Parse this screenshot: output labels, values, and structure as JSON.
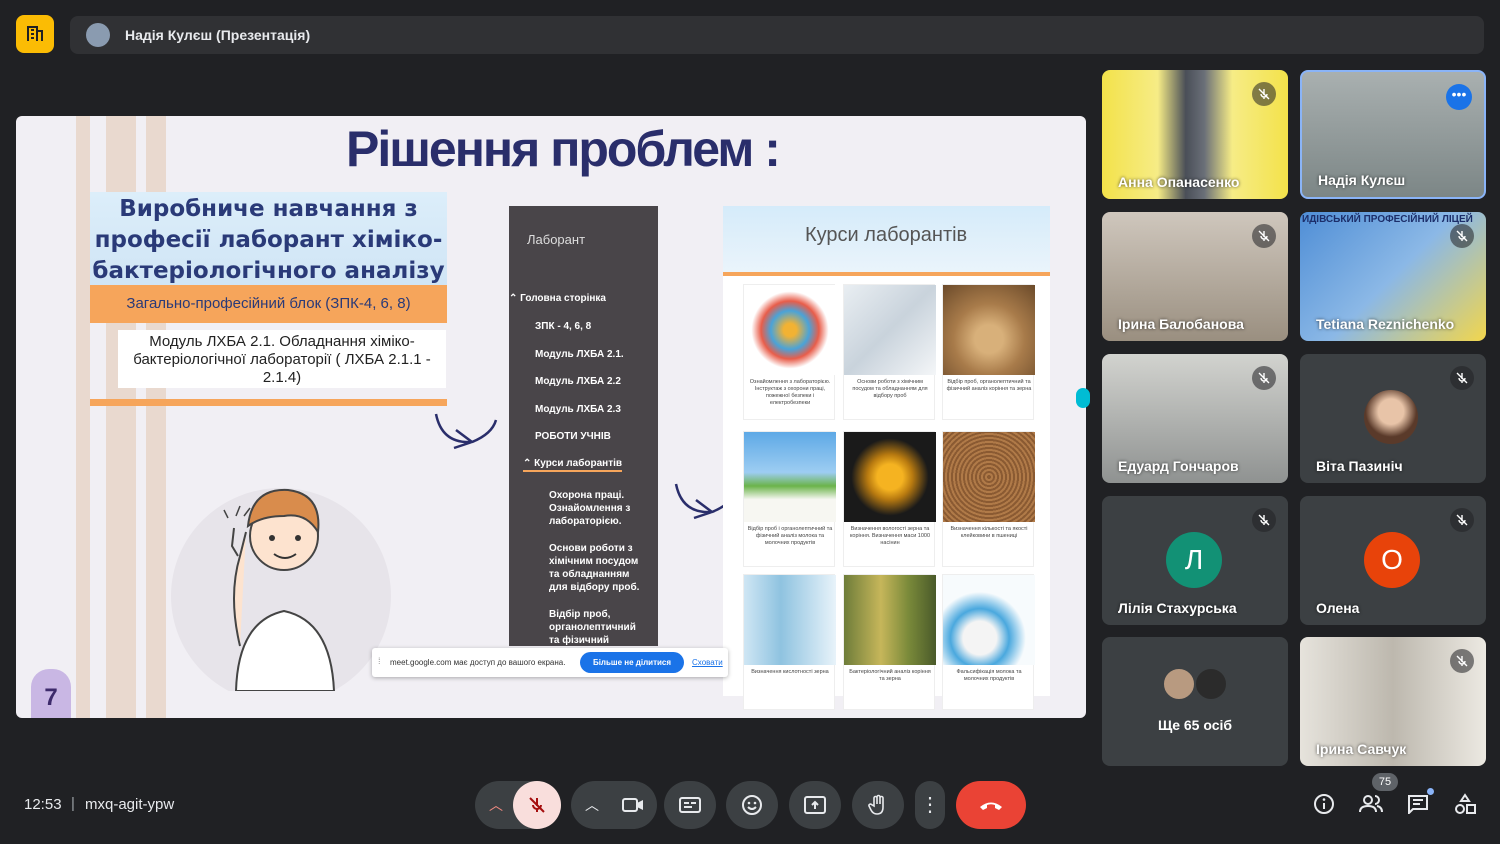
{
  "header": {
    "presenter_title": "Надія Кулєш (Презентація)"
  },
  "slide": {
    "title": "Рішення проблем :",
    "card_title": "Виробниче навчання з професії лаборант хіміко-бактеріологічного аналізу",
    "block_label": "Загально-професійний блок (ЗПК-4, 6, 8)",
    "module_label": "Модуль ЛХБА 2.1. Обладнання хіміко-бактеріологічної лабораторії ( ЛХБА 2.1.1 - 2.1.4)",
    "page_number": "7",
    "nav": {
      "heading": "Лаборант",
      "items": [
        "⌃ Головна сторінка",
        "ЗПК - 4, 6, 8",
        "Модуль ЛХБА 2.1.",
        "Модуль ЛХБА 2.2",
        "Модуль ЛХБА 2.3",
        "РОБОТИ УЧНІВ",
        "⌃ Курси лаборантів",
        "Охорона праці. Ознайомлення з лабораторією.",
        "Основи роботи з хімічним посудом та обладнанням для відбору проб.",
        "Відбір проб, органолептичний та фізичний"
      ]
    },
    "courses": {
      "title": "Курси лаборантів",
      "captions": [
        "Ознайомлення з лабораторією. Інструктаж з охорони праці, пожежної безпеки і електробезпеки",
        "Основи роботи з хімічним посудом та обладнанням для відбору проб",
        "Відбір проб, органолептичний та фізичний аналіз коріння та зерна",
        "Відбір проб і органолептичний та фізичний аналіз молока та молочних продуктів",
        "Визначення вологості зерна та коріння. Визначення маси 1000 насінин",
        "Визначення кількості та якості клейковини в пшениці",
        "Визначення кислотності зерна",
        "Бактеріологічний аналіз коріння та зерна",
        "Фальсифікація молока та молочних продуктів"
      ]
    },
    "share_banner": {
      "text": "meet.google.com має доступ до вашого екрана.",
      "stop_label": "Більше не ділитися",
      "hide_label": "Сховати"
    }
  },
  "participants": [
    {
      "name": "Анна Опанасенко",
      "muted": true
    },
    {
      "name": "Надія Кулєш",
      "muted": false
    },
    {
      "name": "Ірина Балобанова",
      "muted": true
    },
    {
      "name": "Tetiana Reznichenko",
      "muted": true,
      "banner": "ИДІВСЬКИЙ ПРОФЕСІЙНИЙ ЛІЦЕЙ"
    },
    {
      "name": "Едуард Гончаров",
      "muted": true
    },
    {
      "name": "Віта Пазиніч",
      "muted": true
    },
    {
      "name": "Лілія Стахурська",
      "muted": true,
      "initial": "Л",
      "color": "#129175"
    },
    {
      "name": "Олена",
      "muted": true,
      "initial": "О",
      "color": "#e8430a"
    },
    {
      "name": "Ще 65 осіб"
    },
    {
      "name": "Ірина Савчук",
      "muted": true
    }
  ],
  "footer": {
    "time": "12:53",
    "meeting_code": "mxq-agit-ypw",
    "participant_count": "75"
  },
  "colors": {
    "end_call": "#ea4335",
    "mic_off_bg": "#f9dedc",
    "accent": "#8ab4f8"
  }
}
